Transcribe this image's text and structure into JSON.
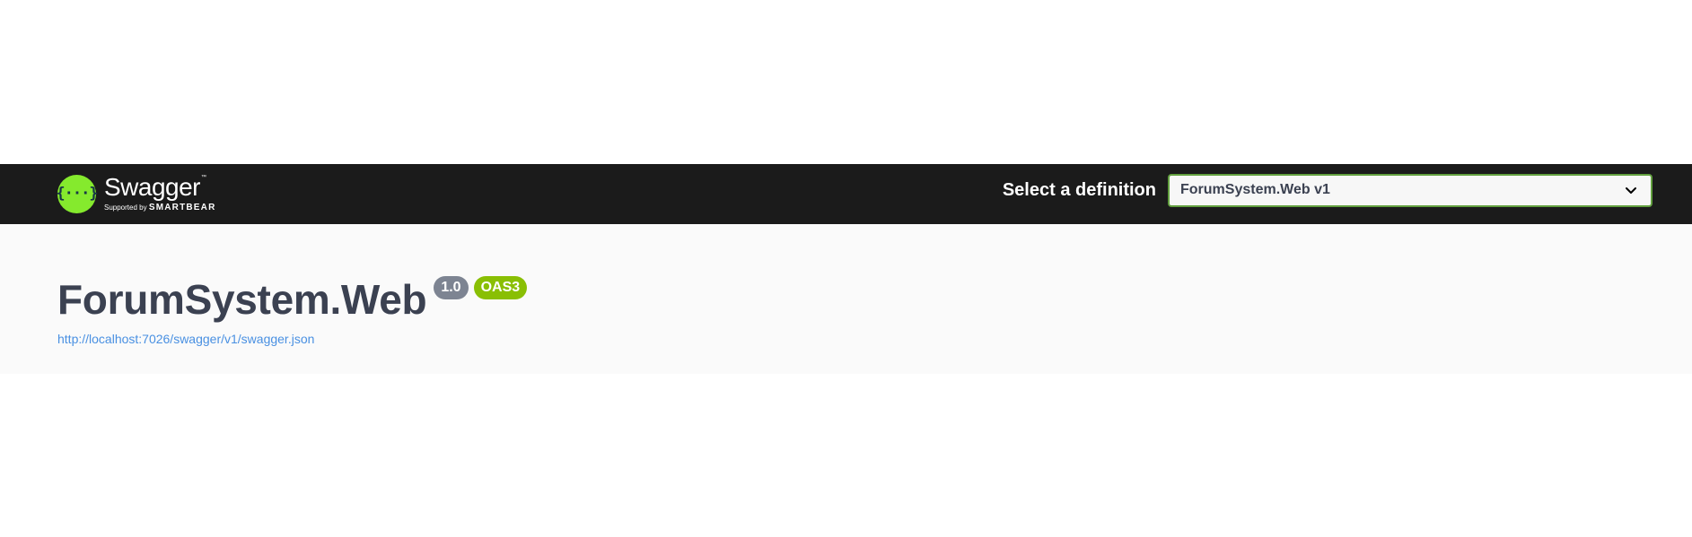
{
  "topbar": {
    "logo": {
      "mark": "{···}",
      "name": "Swagger",
      "trademark": "™",
      "supported_by": "Supported by",
      "brand": "SMARTBEAR"
    },
    "select_label": "Select a definition",
    "selected_definition": "ForumSystem.Web v1"
  },
  "info": {
    "title": "ForumSystem.Web",
    "version_badge": "1.0",
    "spec_badge": "OAS3",
    "spec_url": "http://localhost:7026/swagger/v1/swagger.json"
  },
  "colors": {
    "topbar_bg": "#1b1b1b",
    "logo_green": "#85ea2d",
    "select_border": "#62a03f",
    "version_badge": "#7d8492",
    "oas_badge": "#89bf04",
    "link": "#4990e2",
    "title_text": "#3b4151"
  }
}
